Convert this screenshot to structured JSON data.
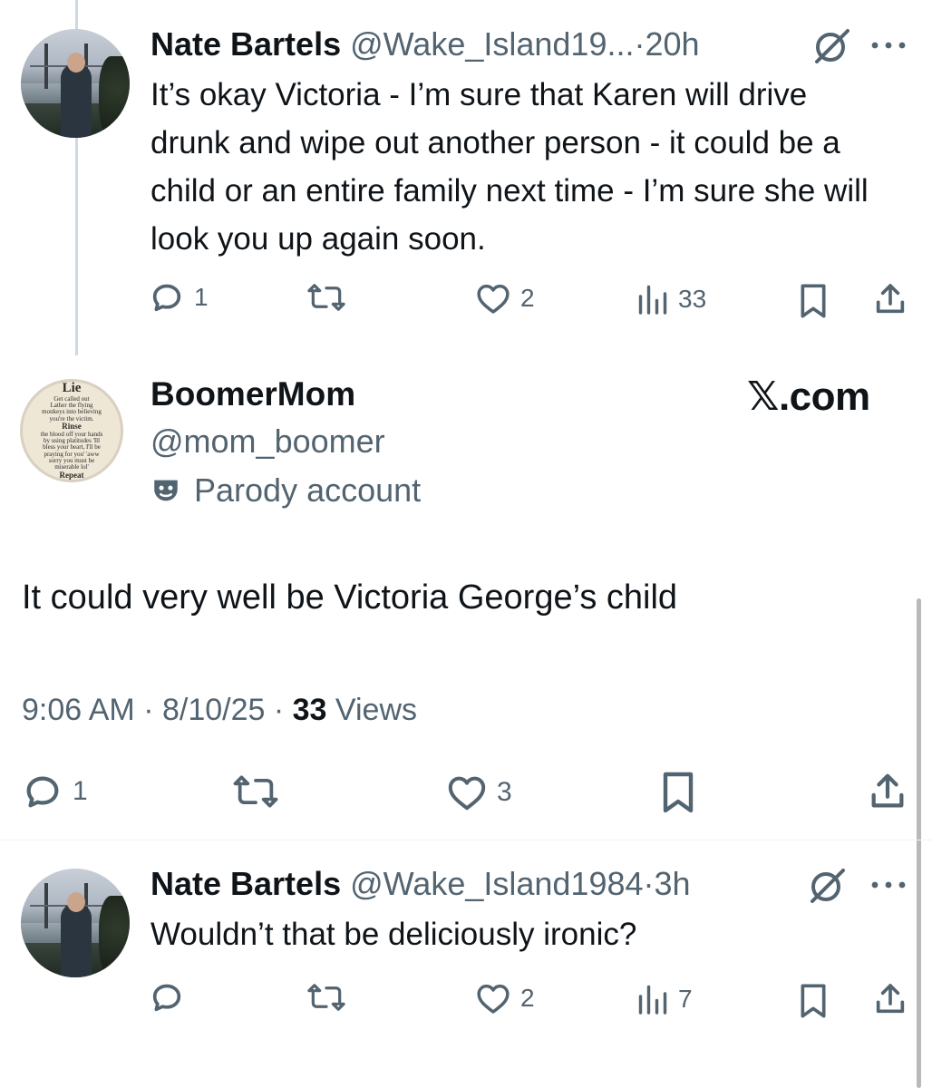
{
  "reply1": {
    "author_name": "Nate Bartels",
    "handle": "@Wake_Island19...",
    "separator": "·",
    "time": "20h",
    "text": "It’s okay Victoria - I’m sure that Karen will drive drunk and wipe out another person - it could be a child or an entire family next time - I’m sure she will look you up again soon.",
    "replies": "1",
    "likes": "2",
    "views": "33"
  },
  "main_tweet": {
    "author_name": "BoomerMom",
    "handle": "@mom_boomer",
    "label": "Parody account",
    "watermark": "𝕏.com",
    "text": "It could very well be Victoria George’s child",
    "time": "9:06 AM",
    "sep1": " · ",
    "date": "8/10/25",
    "sep2": " · ",
    "views_count": "33",
    "views_label": " Views",
    "replies": "1",
    "likes": "3",
    "avatar_lines": {
      "l1": "Lie",
      "l2": "Get called out",
      "l3": "Lather the flying monkeys into believing you're the victim.",
      "l4": "Rinse",
      "l5": "the blood off your hands by using platitudes 'Ill bless your heart, I'll be praying for you' 'aww sorry you must be miserable lol'",
      "l6": "Repeat"
    }
  },
  "reply2": {
    "author_name": "Nate Bartels",
    "handle": "@Wake_Island1984",
    "separator": "·",
    "time": "3h",
    "text": "Wouldn’t that be deliciously ironic?",
    "likes": "2",
    "views": "7"
  },
  "colors": {
    "text": "#0f1419",
    "secondary": "#536471",
    "divider": "#eff3f4"
  },
  "icons": [
    "reply-icon",
    "retweet-icon",
    "like-icon",
    "views-icon",
    "bookmark-icon",
    "share-icon",
    "grok-icon",
    "more-icon",
    "parody-mask-icon"
  ]
}
